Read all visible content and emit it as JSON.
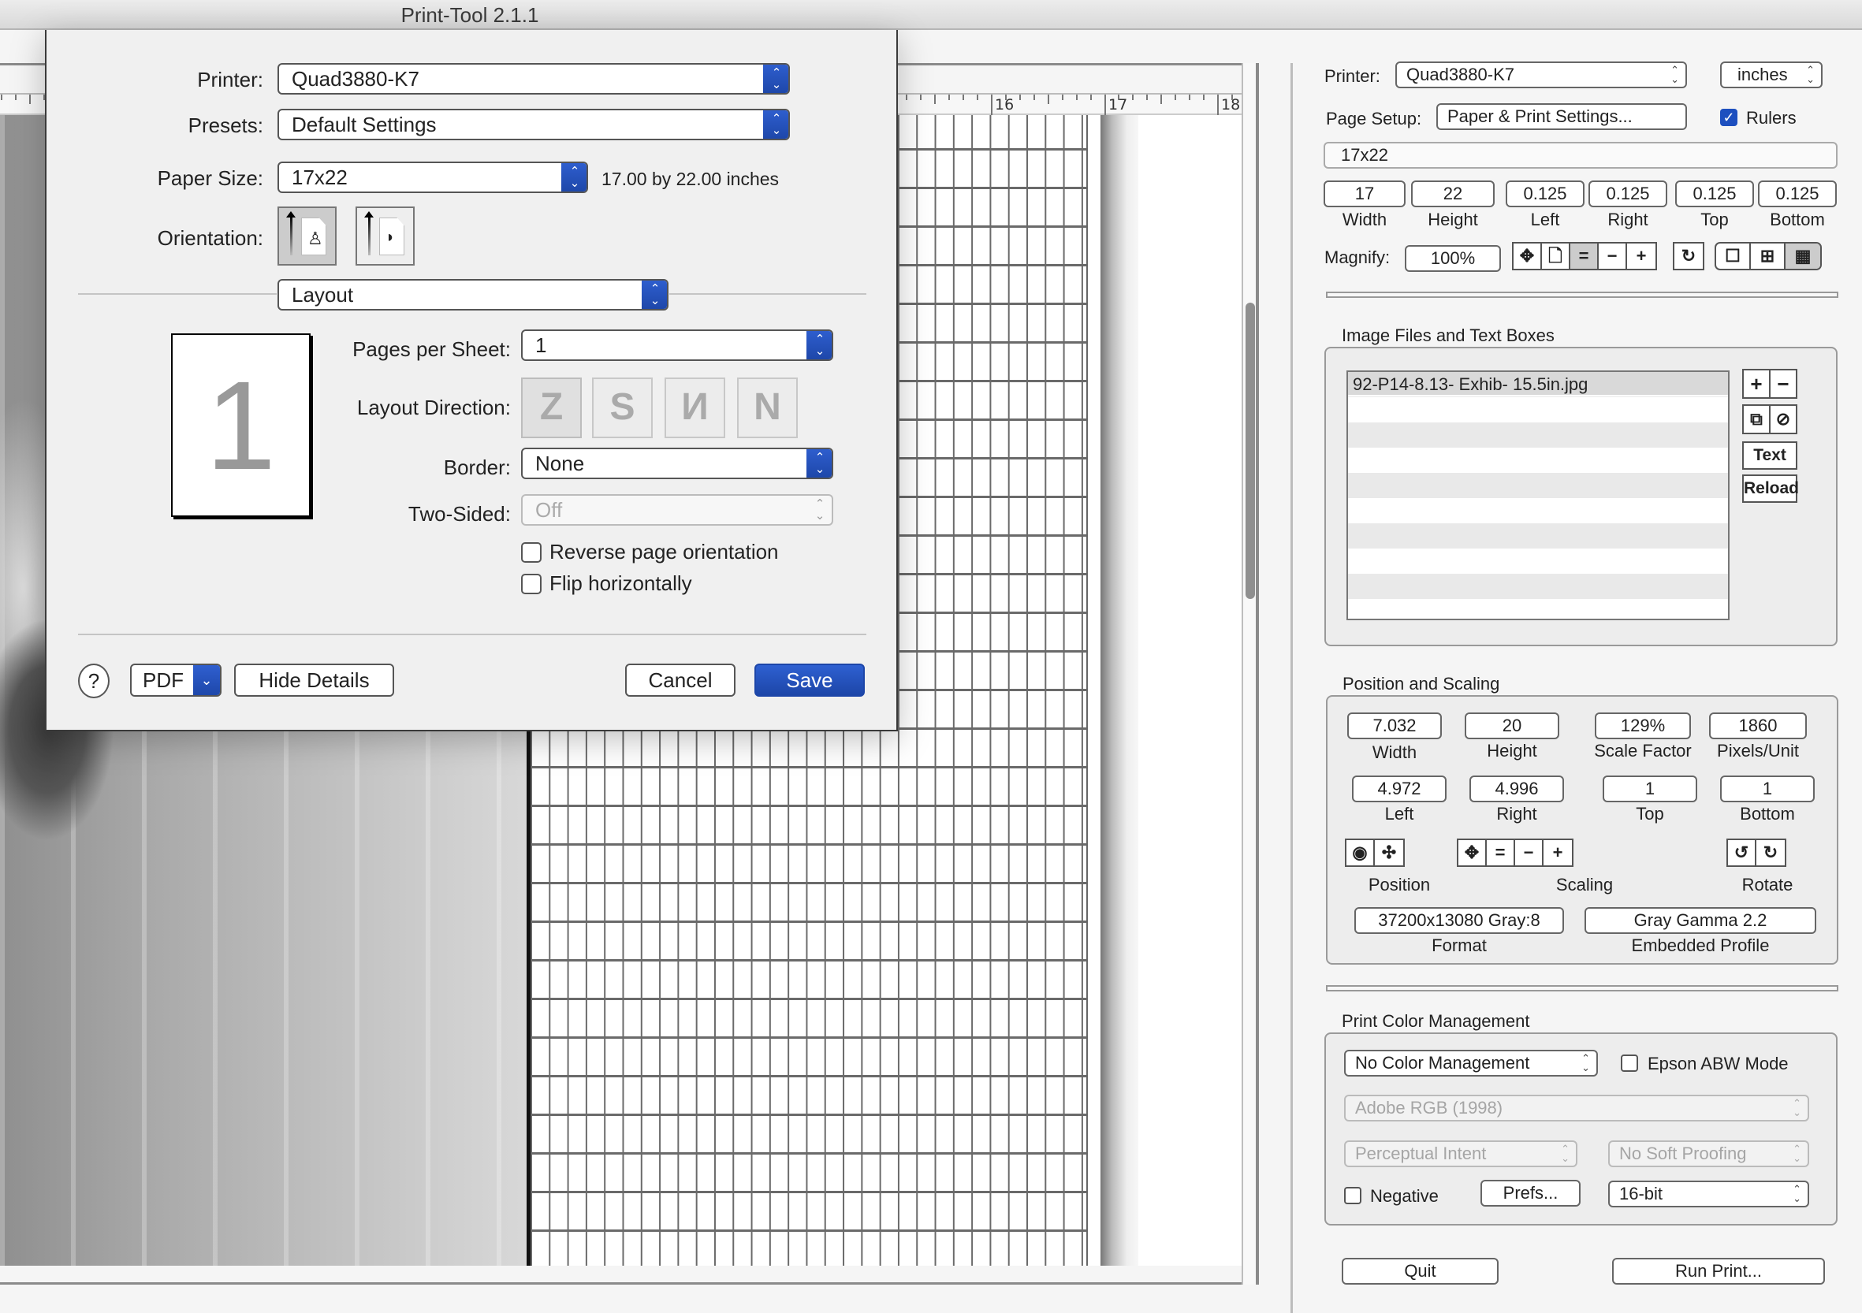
{
  "window": {
    "title": "Print-Tool 2.1.1"
  },
  "ruler": {
    "labels": [
      "16",
      "17",
      "18"
    ]
  },
  "print_dialog": {
    "printer_label": "Printer:",
    "printer_value": "Quad3880-K7",
    "presets_label": "Presets:",
    "presets_value": "Default Settings",
    "paper_size_label": "Paper Size:",
    "paper_size_value": "17x22",
    "paper_size_desc": "17.00 by 22.00 inches",
    "orientation_label": "Orientation:",
    "orientation_options": [
      "portrait",
      "landscape"
    ],
    "orientation_selected": "portrait",
    "section_value": "Layout",
    "preview_page_number": "1",
    "pages_per_sheet_label": "Pages per Sheet:",
    "pages_per_sheet_value": "1",
    "layout_direction_label": "Layout Direction:",
    "layout_direction_options": [
      "Z",
      "S",
      "И",
      "N"
    ],
    "border_label": "Border:",
    "border_value": "None",
    "two_sided_label": "Two-Sided:",
    "two_sided_value": "Off",
    "reverse_orientation_label": "Reverse page orientation",
    "reverse_orientation_checked": false,
    "flip_horizontally_label": "Flip horizontally",
    "flip_horizontally_checked": false,
    "help_label": "?",
    "pdf_label": "PDF",
    "hide_details_label": "Hide Details",
    "cancel_label": "Cancel",
    "save_label": "Save",
    "accent_color": "#1d46a8"
  },
  "right_panel": {
    "printer_label": "Printer:",
    "printer_value": "Quad3880-K7",
    "units_value": "inches",
    "page_setup_label": "Page Setup:",
    "page_setup_button": "Paper & Print Settings...",
    "rulers_label": "Rulers",
    "rulers_checked": true,
    "paper_name": "17x22",
    "paper_fields": [
      {
        "value": "17",
        "label": "Width"
      },
      {
        "value": "22",
        "label": "Height"
      },
      {
        "value": "0.125",
        "label": "Left"
      },
      {
        "value": "0.125",
        "label": "Right"
      },
      {
        "value": "0.125",
        "label": "Top"
      },
      {
        "value": "0.125",
        "label": "Bottom"
      }
    ],
    "magnify_label": "Magnify:",
    "magnify_value": "100%",
    "image_files": {
      "title": "Image Files and Text Boxes",
      "items": [
        "92-P14-8.13- Exhib- 15.5in.jpg"
      ],
      "add_label": "+",
      "remove_label": "−",
      "text_label": "Text",
      "reload_label": "Reload"
    },
    "position_scaling": {
      "title": "Position and Scaling",
      "row1": [
        {
          "value": "7.032",
          "label": "Width"
        },
        {
          "value": "20",
          "label": "Height"
        },
        {
          "value": "129%",
          "label": "Scale Factor"
        },
        {
          "value": "1860",
          "label": "Pixels/Unit"
        }
      ],
      "row2": [
        {
          "value": "4.972",
          "label": "Left"
        },
        {
          "value": "4.996",
          "label": "Right"
        },
        {
          "value": "1",
          "label": "Top"
        },
        {
          "value": "1",
          "label": "Bottom"
        }
      ],
      "position_label": "Position",
      "scaling_label": "Scaling",
      "rotate_label": "Rotate",
      "format_value": "37200x13080 Gray:8",
      "format_label": "Format",
      "profile_value": "Gray Gamma 2.2",
      "profile_label": "Embedded Profile"
    },
    "color_mgmt": {
      "title": "Print Color Management",
      "mode_value": "No Color Management",
      "epson_abw_label": "Epson ABW Mode",
      "epson_abw_checked": false,
      "profile_value": "Adobe RGB (1998)",
      "intent_value": "Perceptual Intent",
      "soft_proof_value": "No Soft Proofing",
      "negative_label": "Negative",
      "negative_checked": false,
      "prefs_label": "Prefs...",
      "bit_depth_value": "16-bit"
    },
    "quit_label": "Quit",
    "run_print_label": "Run Print..."
  }
}
